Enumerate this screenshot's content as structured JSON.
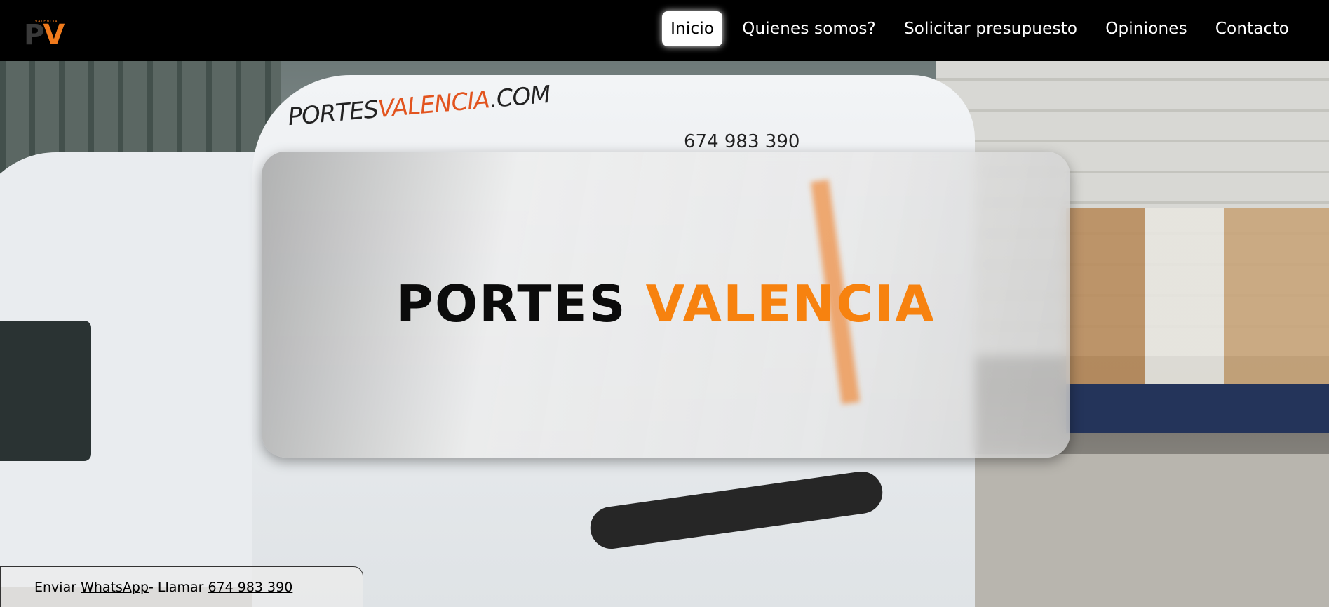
{
  "header": {
    "logo": {
      "small_text": "VALENCIA",
      "letters_p": "P",
      "letters_v": "V"
    },
    "nav": [
      {
        "label": "Inicio",
        "active": true
      },
      {
        "label": "Quienes somos?",
        "active": false
      },
      {
        "label": "Solicitar presupuesto",
        "active": false
      },
      {
        "label": "Opiniones",
        "active": false
      },
      {
        "label": "Contacto",
        "active": false
      }
    ]
  },
  "hero": {
    "title_black": "PORTES",
    "title_orange": "VALENCIA",
    "van_text_main": "PORTES",
    "van_text_orange": "VALENCIA",
    "van_text_suffix": ".COM",
    "van_phone": "674 983 390"
  },
  "contact_bar": {
    "prefix": "Enviar ",
    "whatsapp_label": "WhatsApp ",
    "separator": "- Llamar ",
    "phone_label": "674 983 390"
  },
  "colors": {
    "accent_orange": "#f7820f",
    "header_bg": "#000000",
    "active_nav_bg": "#ffffff"
  }
}
